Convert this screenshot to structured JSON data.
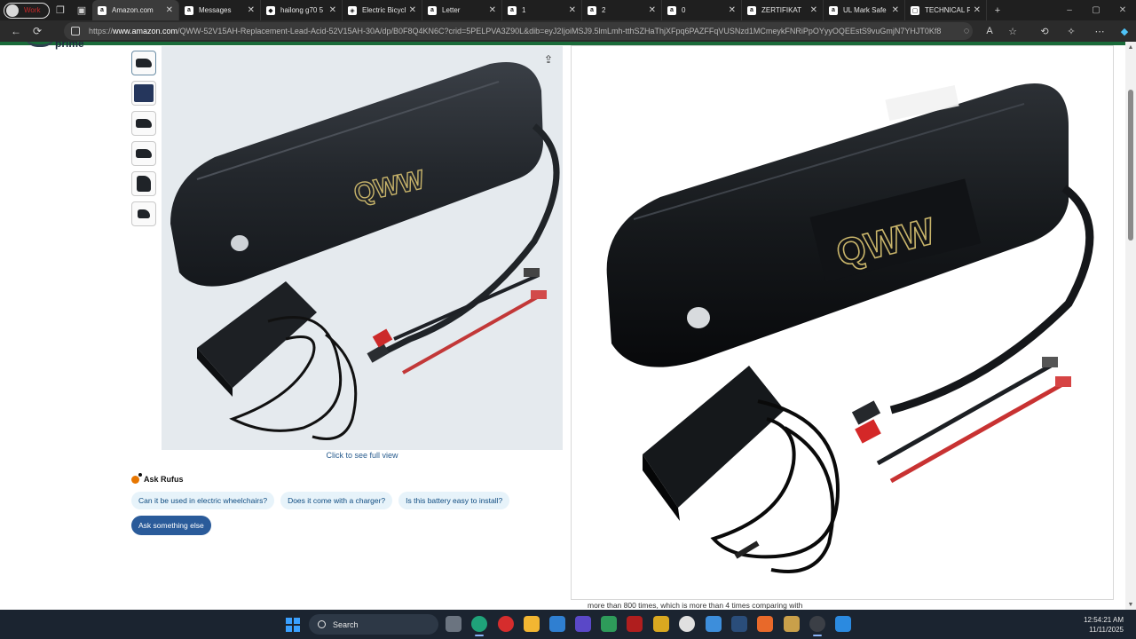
{
  "browser": {
    "profile_label": "Work",
    "tabs": [
      {
        "label": "Amazon.com",
        "favicon": "a",
        "active": true
      },
      {
        "label": "Messages",
        "favicon": "a",
        "active": false
      },
      {
        "label": "hailong g70 5",
        "favicon": "◆",
        "active": false
      },
      {
        "label": "Electric Bicycl",
        "favicon": "◈",
        "active": false
      },
      {
        "label": "Letter",
        "favicon": "a",
        "active": false
      },
      {
        "label": "1",
        "favicon": "a",
        "active": false
      },
      {
        "label": "2",
        "favicon": "a",
        "active": false
      },
      {
        "label": "0",
        "favicon": "a",
        "active": false
      },
      {
        "label": "ZERTIFIKAT",
        "favicon": "a",
        "active": false
      },
      {
        "label": "UL Mark Safe",
        "favicon": "a",
        "active": false
      },
      {
        "label": "TECHNICAL F",
        "favicon": "▢",
        "active": false
      }
    ],
    "url_prefix": "https://",
    "url_domain": "www.amazon.com",
    "url_path": "/QWW-52V15AH-Replacement-Lead-Acid-52V15AH-30A/dp/B0F8Q4KN6C?crid=5PELPVA3Z90L&dib=eyJ2IjoiMSJ9.5lmLmh-tthSZHaThjXFpq6PAZFFqVUSNzd1MCmeykFNRiPpOYyyOQEEstS9vuGmjN7YHJT0Kf8..."
  },
  "page": {
    "prime_word": "prime",
    "battery_brand_text": "QWW",
    "see_full_view": "Click to see full view",
    "rufus": {
      "title": "Ask Rufus",
      "chips": [
        "Can it be used in electric wheelchairs?",
        "Does it come with a charger?",
        "Is this battery easy to install?"
      ],
      "ask_button": "Ask something else"
    },
    "below_text": "more than 800 times, which is more than 4 times comparing with"
  },
  "taskbar": {
    "search_label": "Search",
    "time": "12:54:21 AM",
    "date": "11/11/2025"
  },
  "colors": {
    "prime_green": "#1a6b3a",
    "chip_bg": "#e7f3fa",
    "chip_text": "#0f4c81",
    "ask_button_bg": "#2a5b9a",
    "battery_logo_gold": "#c8b46a"
  }
}
